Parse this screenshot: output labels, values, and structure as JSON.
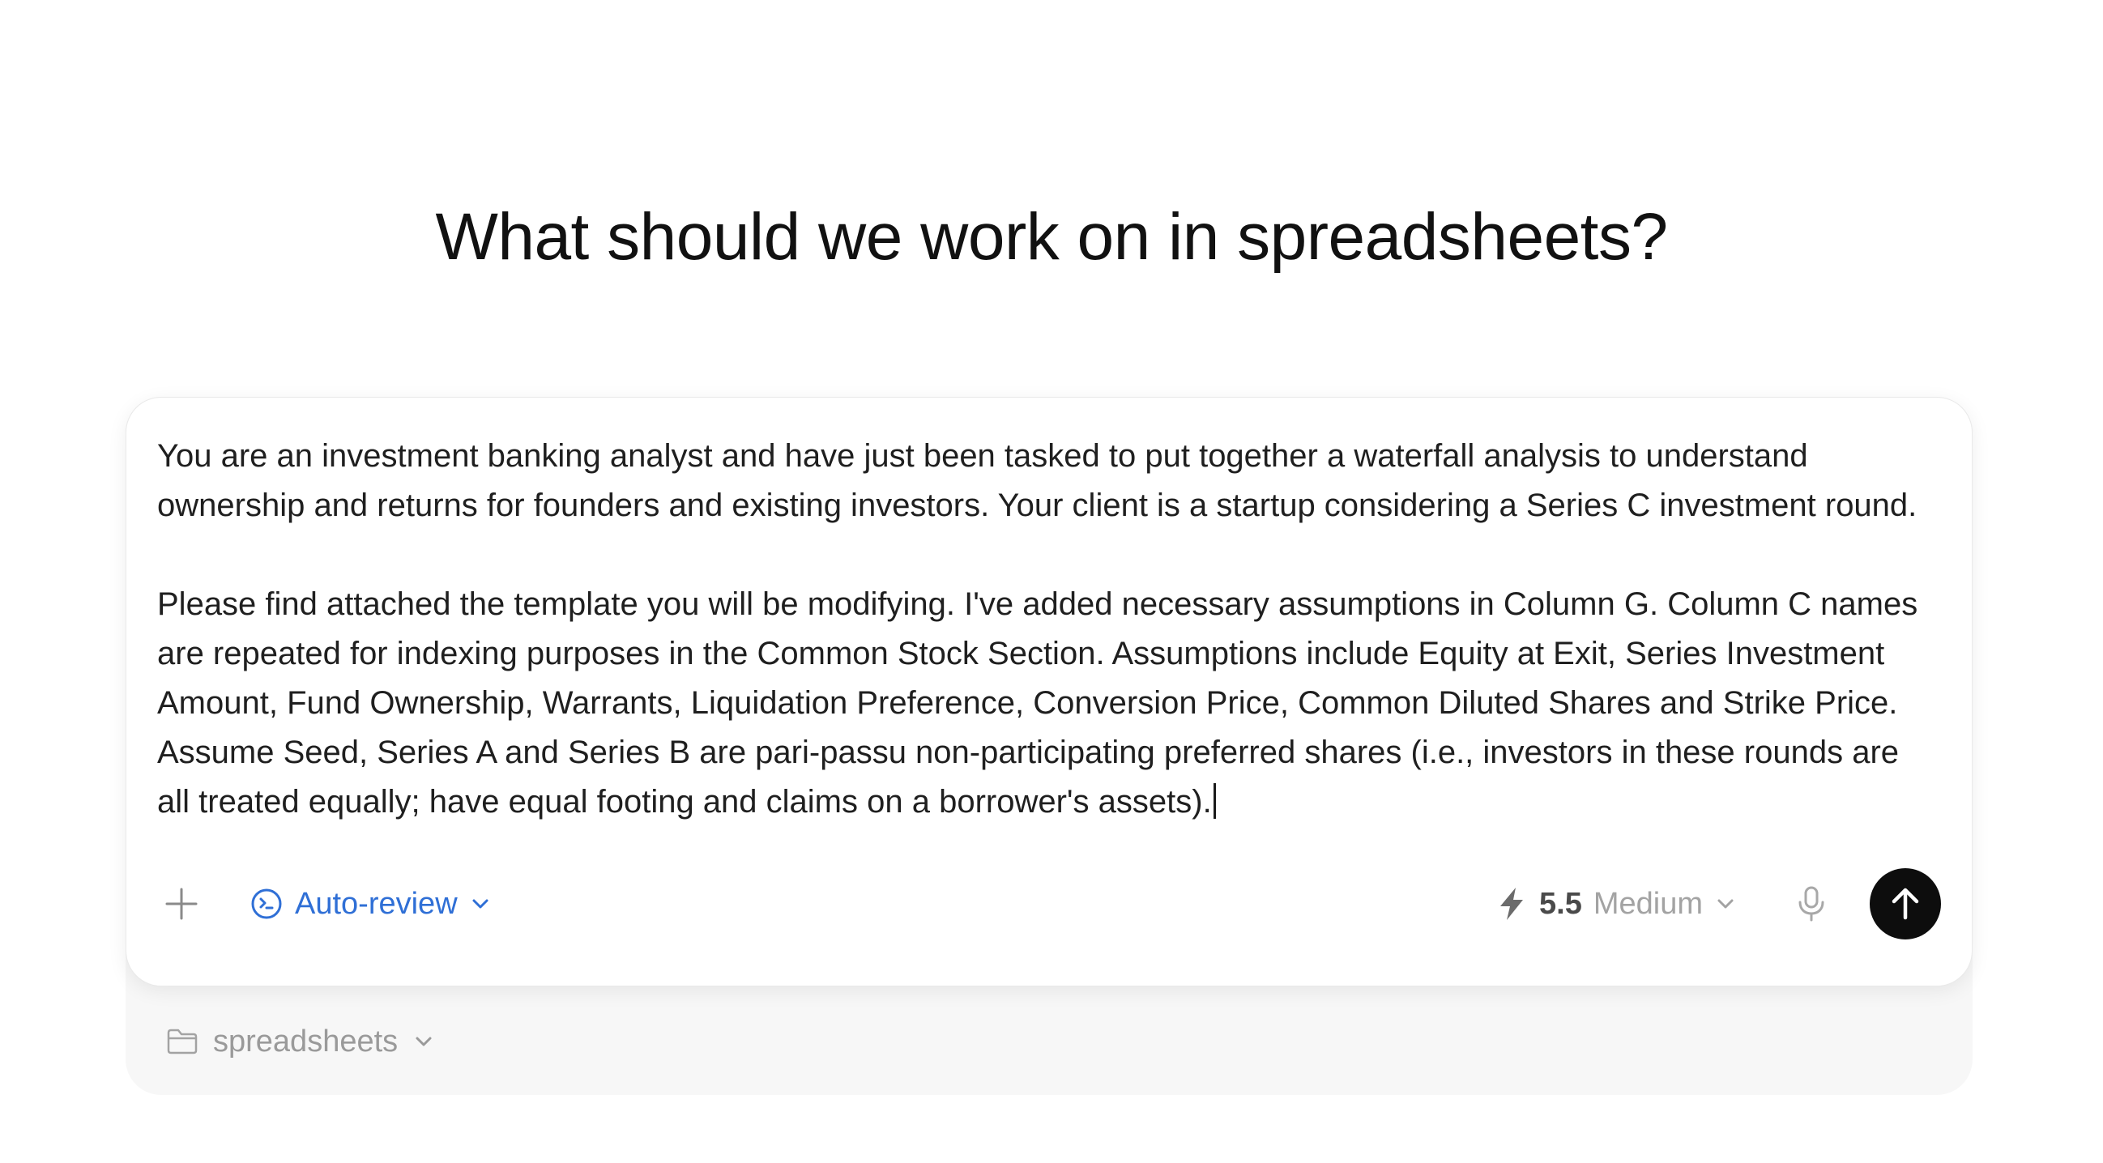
{
  "heading": "What should we work on in spreadsheets?",
  "composer": {
    "prompt_paragraphs": [
      "You are an investment banking analyst and have just been tasked to put together a waterfall analysis to understand ownership and returns for founders and existing investors. Your client is a startup considering a Series C investment round.",
      "Please find attached the template you will be modifying. I've added necessary assumptions in Column G. Column C names are repeated for indexing purposes in the Common Stock Section. Assumptions include Equity at Exit, Series Investment Amount, Fund Ownership, Warrants, Liquidation Preference, Conversion Price, Common Diluted Shares and Strike Price. Assume Seed, Series A and Series B are pari-passu non-participating preferred shares (i.e., investors in these rounds are all treated equally; have equal footing and claims on a borrower's assets)."
    ],
    "toolbar": {
      "add_icon": "plus-icon",
      "review_mode_label": "Auto-review",
      "review_icon": "auto-review-icon",
      "model_version": "5.5",
      "model_effort": "Medium",
      "model_icon": "lightning-icon",
      "mic_icon": "microphone-icon",
      "send_icon": "arrow-up-icon"
    }
  },
  "project": {
    "folder_label": "spreadsheets",
    "folder_icon": "folder-icon"
  },
  "colors": {
    "accent_blue": "#2f6fd6",
    "send_button": "#0d0d0d",
    "muted_text": "#9a9a9a"
  }
}
